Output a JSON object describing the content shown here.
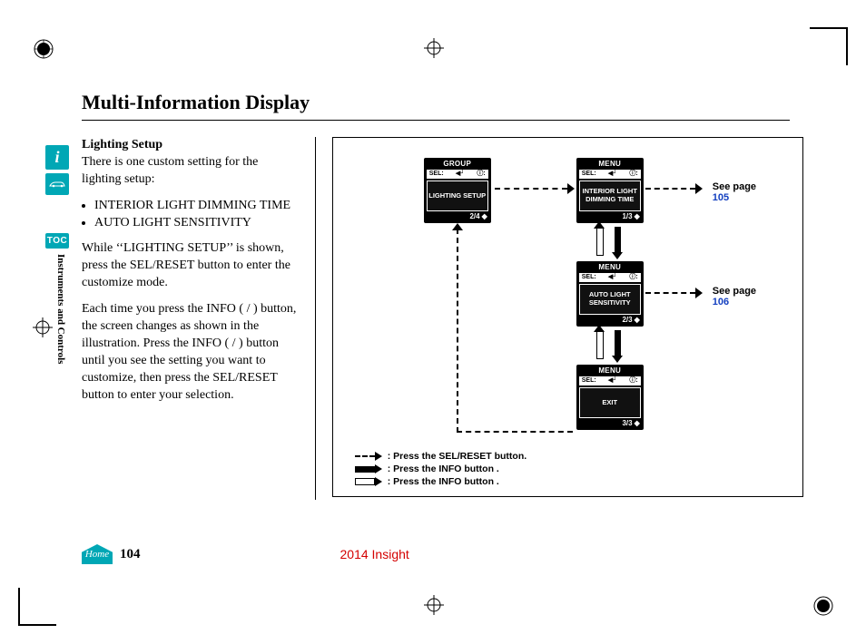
{
  "title": "Multi-Information Display",
  "sideTabs": {
    "info": "i",
    "toc": "TOC",
    "sectionLabel": "Instruments and Controls",
    "home": "Home"
  },
  "body": {
    "heading": "Lighting Setup",
    "intro": "There is one custom setting for the lighting setup:",
    "items": [
      "INTERIOR LIGHT DIMMING TIME",
      "AUTO LIGHT SENSITIVITY"
    ],
    "p1": "While ‘‘LIGHTING SETUP’’ is shown, press the SEL/RESET button to enter the customize mode.",
    "p2": "Each time you press the INFO (    /    ) button, the screen changes as shown in the illustration. Press the INFO (    /    ) button until you see the setting you want to customize, then press the SEL/RESET button to enter your selection."
  },
  "screens": {
    "group": {
      "header": "GROUP",
      "sel": "SEL:",
      "label": "LIGHTING SETUP",
      "page": "2/4"
    },
    "menu1": {
      "header": "MENU",
      "sel": "SEL:",
      "label": "INTERIOR LIGHT DIMMING TIME",
      "page": "1/3"
    },
    "menu2": {
      "header": "MENU",
      "sel": "SEL:",
      "label": "AUTO LIGHT SENSITIVITY",
      "page": "2/3"
    },
    "menu3": {
      "header": "MENU",
      "sel": "SEL:",
      "label": "EXIT",
      "page": "3/3"
    }
  },
  "refs": {
    "see1": {
      "label": "See page",
      "page": "105"
    },
    "see2": {
      "label": "See page",
      "page": "106"
    }
  },
  "legend": {
    "l1": ": Press the SEL/RESET button.",
    "l2": ": Press the INFO button     .",
    "l3": ": Press the INFO button     ."
  },
  "footer": {
    "pageNum": "104",
    "model": "2014 Insight"
  }
}
